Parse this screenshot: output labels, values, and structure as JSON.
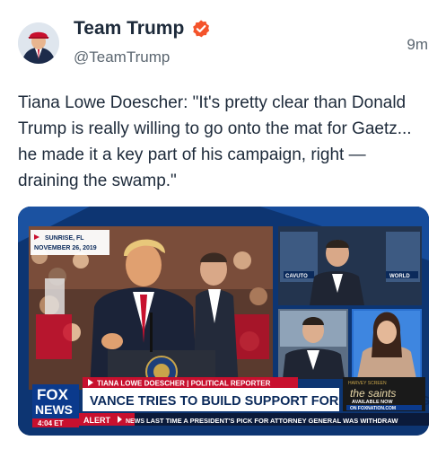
{
  "post": {
    "display_name": "Team Trump",
    "handle": "@TeamTrump",
    "time": "9m",
    "text": "Tiana Lowe Doescher: \"It's pretty clear than Donald Trump is really willing to go onto the mat for Gaetz... he made it a key part of his campaign, right — draining the swamp.\""
  },
  "media": {
    "dateline_location": "SUNRISE, FL",
    "dateline_date": "NOVEMBER 26, 2019",
    "speaker_label": "TIANA LOWE DOESCHER | POLITICAL REPORTER",
    "headline": "VANCE TRIES TO BUILD SUPPORT FOR GAETZ AS AG",
    "network_top": "FOX",
    "network_bottom": "NEWS",
    "clock": "4:04 ET",
    "alert_label": "ALERT",
    "ticker_label": "NEWS",
    "ticker_text": "LAST TIME A PRESIDENT'S PICK FOR ATTORNEY GENERAL WAS WITHDRAW",
    "promo_title": "the saints",
    "promo_top": "HARVEY SCREEN",
    "promo_sub": "AVAILABLE NOW",
    "promo_on": "ON FOXNATION.COM",
    "panel_label_1": "CAVUTO",
    "panel_label_2": "WORLD"
  },
  "colors": {
    "name": "#1d2a3a",
    "muted": "#5b6670",
    "verified": "#f4542b",
    "fox_blue": "#0b3a8c",
    "fox_red": "#c8102e"
  }
}
